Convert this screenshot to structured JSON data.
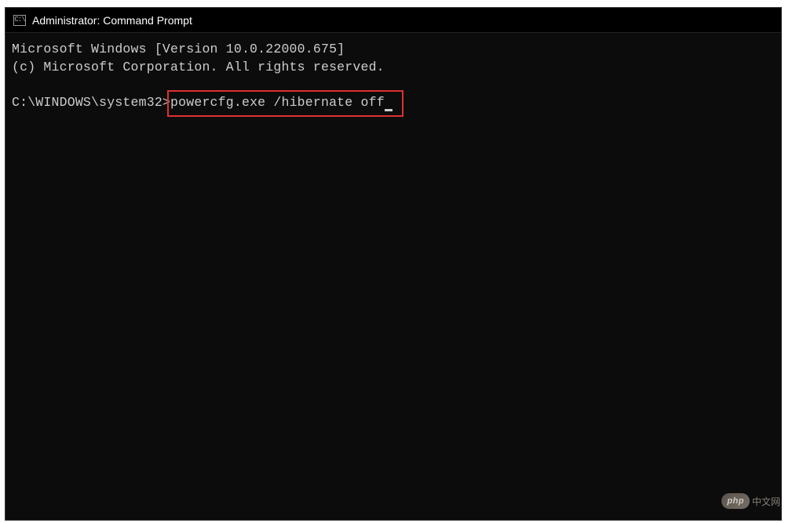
{
  "titlebar": {
    "icon_label": "cmd-icon",
    "title": "Administrator: Command Prompt"
  },
  "terminal": {
    "line1": "Microsoft Windows [Version 10.0.22000.675]",
    "line2": "(c) Microsoft Corporation. All rights reserved.",
    "prompt": "C:\\WINDOWS\\system32>",
    "command": "powercfg.exe /hibernate off"
  },
  "watermark": {
    "badge": "php",
    "text": "中文网"
  }
}
